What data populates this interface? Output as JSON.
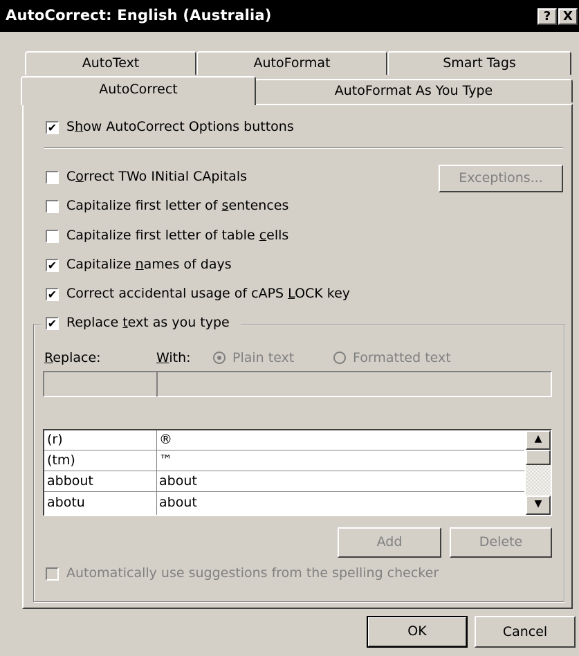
{
  "window": {
    "title": "AutoCorrect: English (Australia)",
    "help_label": "?",
    "close_label": "X"
  },
  "tabs_back": [
    "AutoText",
    "AutoFormat",
    "Smart Tags"
  ],
  "tabs_front": [
    "AutoCorrect",
    "AutoFormat As You Type"
  ],
  "options": {
    "show_buttons": {
      "pre": "S",
      "u": "h",
      "post": "ow AutoCorrect Options buttons",
      "checked": true
    },
    "two_initials": {
      "pre": "C",
      "u": "o",
      "post": "rrect TWo INitial CApitals",
      "checked": false
    },
    "sentences": {
      "pre": "Capitalize first letter of ",
      "u": "s",
      "post": "entences",
      "checked": false
    },
    "table_cells": {
      "pre": "Capitalize first letter of table ",
      "u": "c",
      "post": "ells",
      "checked": false
    },
    "days": {
      "pre": "Capitalize ",
      "u": "n",
      "post": "ames of days",
      "checked": true
    },
    "caps_lock": {
      "pre": "Correct accidental usage of cAPS ",
      "u": "L",
      "post": "OCK key",
      "checked": true
    },
    "replace_text": {
      "pre": "Replace ",
      "u": "t",
      "post": "ext as you type",
      "checked": true
    },
    "auto_suggest": {
      "label": "Automatically use suggestions from the spelling checker",
      "checked": false
    }
  },
  "buttons": {
    "exceptions": "Exceptions...",
    "add": "Add",
    "delete": "Delete",
    "ok": "OK",
    "cancel": "Cancel"
  },
  "replace_section": {
    "replace_pre": "",
    "replace_u": "R",
    "replace_post": "eplace:",
    "with_pre": "",
    "with_u": "W",
    "with_post": "ith:",
    "plain_text": "Plain text",
    "formatted_text": "Formatted text",
    "replace_value": "",
    "with_value": ""
  },
  "list": [
    {
      "replace": "(r)",
      "with": "®"
    },
    {
      "replace": "(tm)",
      "with": "™"
    },
    {
      "replace": "abbout",
      "with": "about"
    },
    {
      "replace": "abotu",
      "with": "about"
    }
  ],
  "icons": {
    "scroll_up": "▲",
    "scroll_down": "▼",
    "check": "✔"
  }
}
